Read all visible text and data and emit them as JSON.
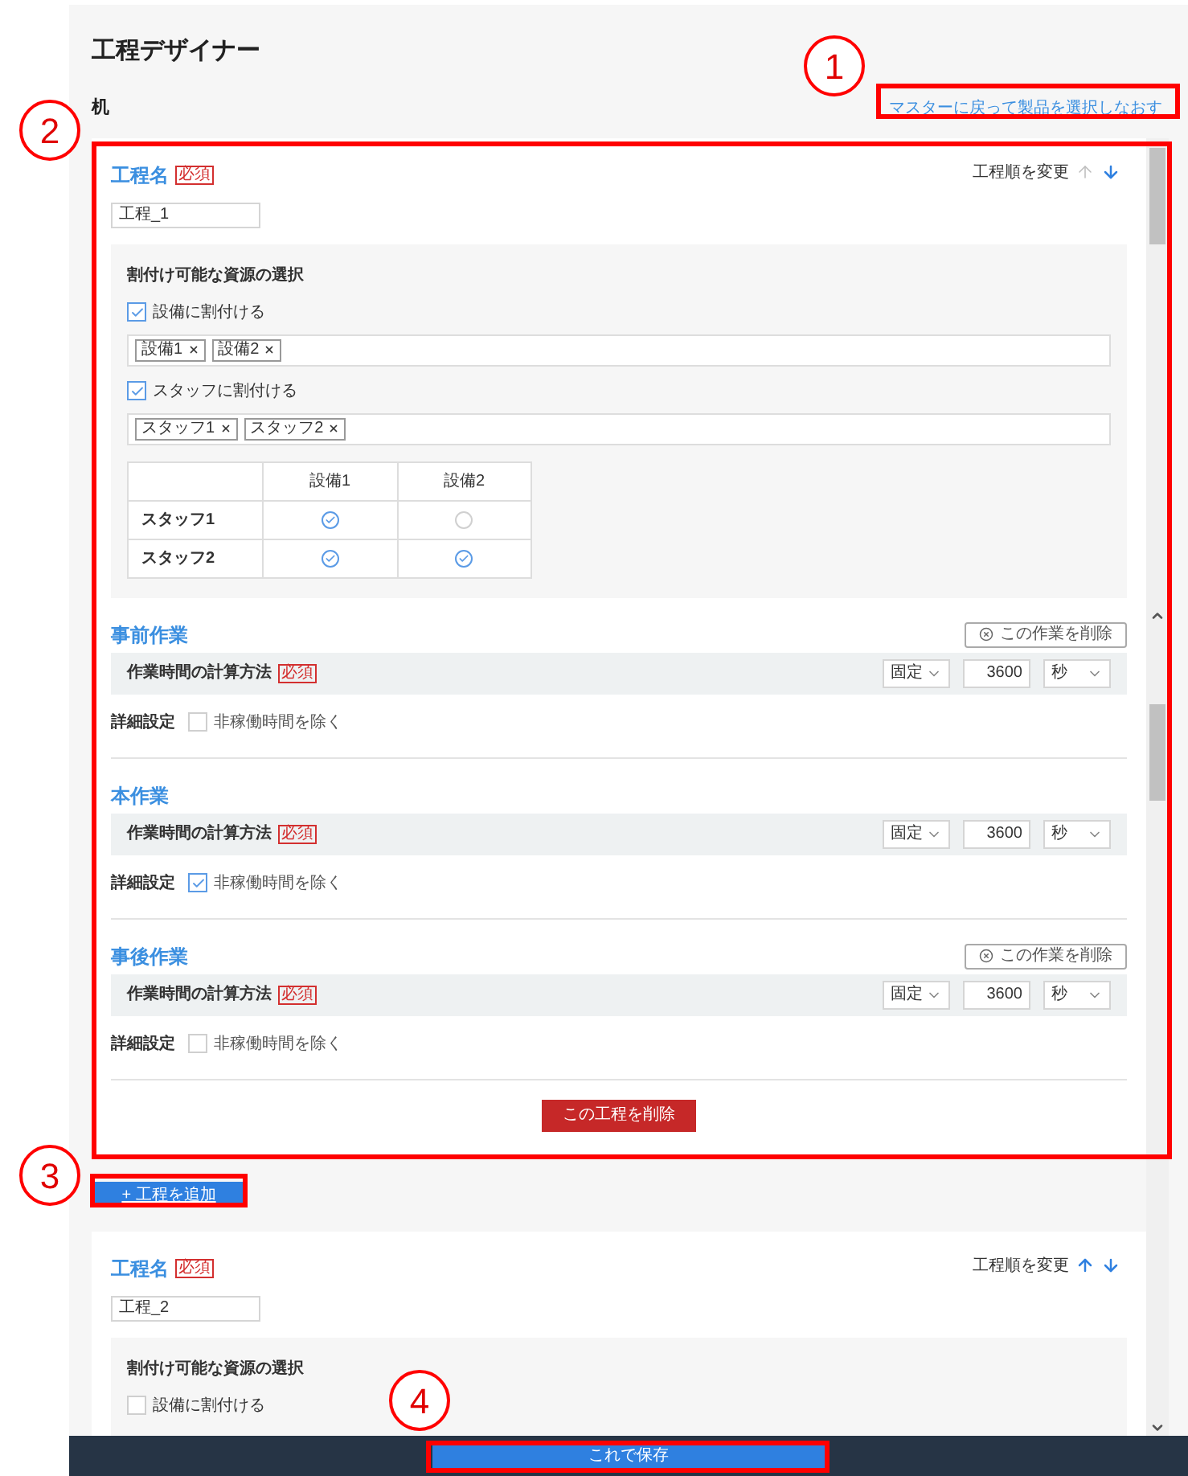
{
  "title": "工程デザイナー",
  "product": "机",
  "back_link": "マスターに戻って製品を選択しなおす",
  "processes": [
    {
      "name_label": "工程名",
      "required": "必須",
      "name_value": "工程_1",
      "reorder_label": "工程順を変更",
      "move_up_enabled": false,
      "move_down_enabled": true,
      "resources": {
        "title": "割付け可能な資源の選択",
        "groups": [
          {
            "label": "設備に割付ける",
            "checked": true,
            "tags": [
              "設備1",
              "設備2"
            ]
          },
          {
            "label": "スタッフに割付ける",
            "checked": true,
            "tags": [
              "スタッフ1",
              "スタッフ2"
            ]
          }
        ],
        "matrix": {
          "columns": [
            "設備1",
            "設備2"
          ],
          "rows": [
            {
              "label": "スタッフ1",
              "cells": [
                {
                  "checked": true
                },
                {
                  "checked": false
                }
              ]
            },
            {
              "label": "スタッフ2",
              "cells": [
                {
                  "checked": true
                },
                {
                  "checked": true
                }
              ]
            }
          ]
        }
      },
      "tasks": [
        {
          "title": "事前作業",
          "delete_button": "この作業を削除",
          "calc_label": "作業時間の計算方法",
          "required": "必須",
          "method": "固定",
          "amount": "3600",
          "unit": "秒",
          "detail_label": "詳細設定",
          "exclude_label": "非稼働時間を除く",
          "exclude_checked": false
        },
        {
          "title": "本作業",
          "calc_label": "作業時間の計算方法",
          "required": "必須",
          "method": "固定",
          "amount": "3600",
          "unit": "秒",
          "detail_label": "詳細設定",
          "exclude_label": "非稼働時間を除く",
          "exclude_checked": true
        },
        {
          "title": "事後作業",
          "delete_button": "この作業を削除",
          "calc_label": "作業時間の計算方法",
          "required": "必須",
          "method": "固定",
          "amount": "3600",
          "unit": "秒",
          "detail_label": "詳細設定",
          "exclude_label": "非稼働時間を除く",
          "exclude_checked": false
        }
      ],
      "delete_process": "この工程を削除"
    },
    {
      "name_label": "工程名",
      "required": "必須",
      "name_value": "工程_2",
      "reorder_label": "工程順を変更",
      "move_up_enabled": true,
      "move_down_enabled": true,
      "resources": {
        "title": "割付け可能な資源の選択",
        "groups": [
          {
            "label": "設備に割付ける",
            "checked": false
          }
        ]
      }
    }
  ],
  "add_process": "+ 工程を追加",
  "save_button": "これで保存",
  "callouts": [
    {
      "number": "1"
    },
    {
      "number": "2"
    },
    {
      "number": "3"
    },
    {
      "number": "4"
    }
  ]
}
